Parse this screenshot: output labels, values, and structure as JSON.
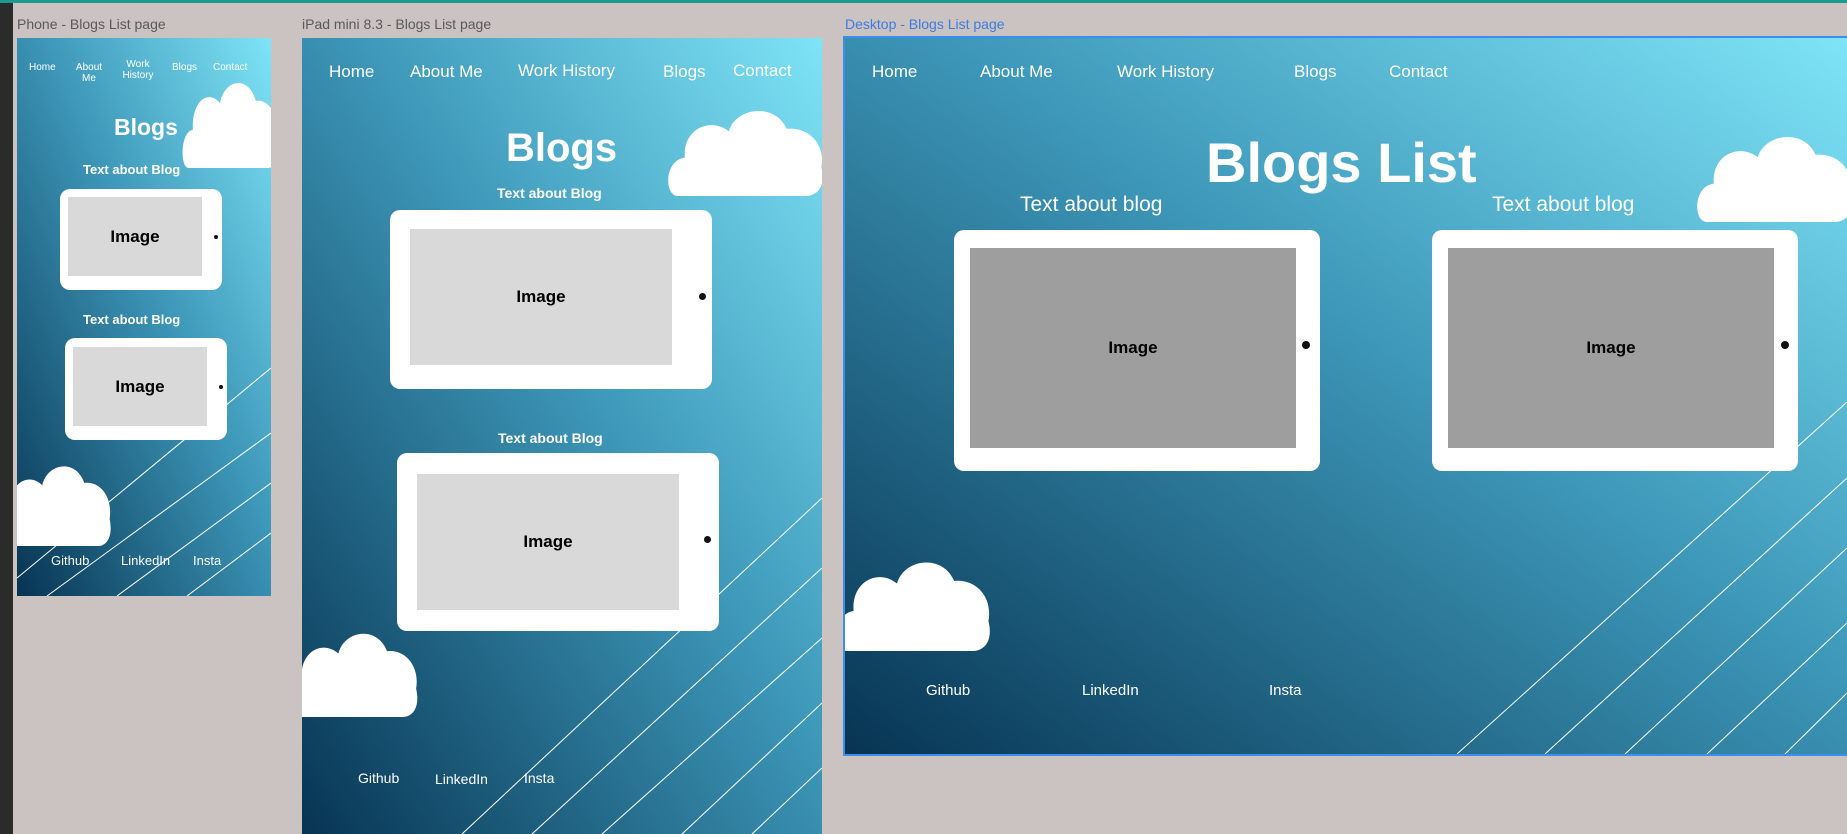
{
  "frames": {
    "phone": {
      "title": "Phone - Blogs List page",
      "nav": {
        "home": "Home",
        "about": "About Me",
        "work": "Work History",
        "blogs": "Blogs",
        "contact": "Contact"
      },
      "heading": "Blogs",
      "posts": [
        {
          "text": "Text about Blog",
          "image_label": "Image"
        },
        {
          "text": "Text about Blog",
          "image_label": "Image"
        }
      ],
      "footer": {
        "github": "Github",
        "linkedin": "LinkedIn",
        "insta": "Insta"
      }
    },
    "ipad": {
      "title": "iPad mini 8.3 - Blogs List page",
      "nav": {
        "home": "Home",
        "about": "About Me",
        "work": "Work History",
        "blogs": "Blogs",
        "contact": "Contact"
      },
      "heading": "Blogs",
      "posts": [
        {
          "text": "Text about Blog",
          "image_label": "Image"
        },
        {
          "text": "Text about Blog",
          "image_label": "Image"
        }
      ],
      "footer": {
        "github": "Github",
        "linkedin": "LinkedIn",
        "insta": "Insta"
      }
    },
    "desktop": {
      "title": "Desktop - Blogs List page",
      "nav": {
        "home": "Home",
        "about": "About Me",
        "work": "Work History",
        "blogs": "Blogs",
        "contact": "Contact"
      },
      "heading": "Blogs List",
      "posts": [
        {
          "text": "Text about blog",
          "image_label": "Image"
        },
        {
          "text": "Text about blog",
          "image_label": "Image"
        }
      ],
      "footer": {
        "github": "Github",
        "linkedin": "LinkedIn",
        "insta": "Insta"
      }
    }
  },
  "colors": {
    "canvas": "#cbc2c2",
    "gradient_light": "#7fe4f7",
    "gradient_dark": "#0a3a5a",
    "card": "#ffffff",
    "image_placeholder_light": "#d9d9d9",
    "image_placeholder_dark": "#9e9e9e",
    "selection": "#3b8fe8"
  }
}
